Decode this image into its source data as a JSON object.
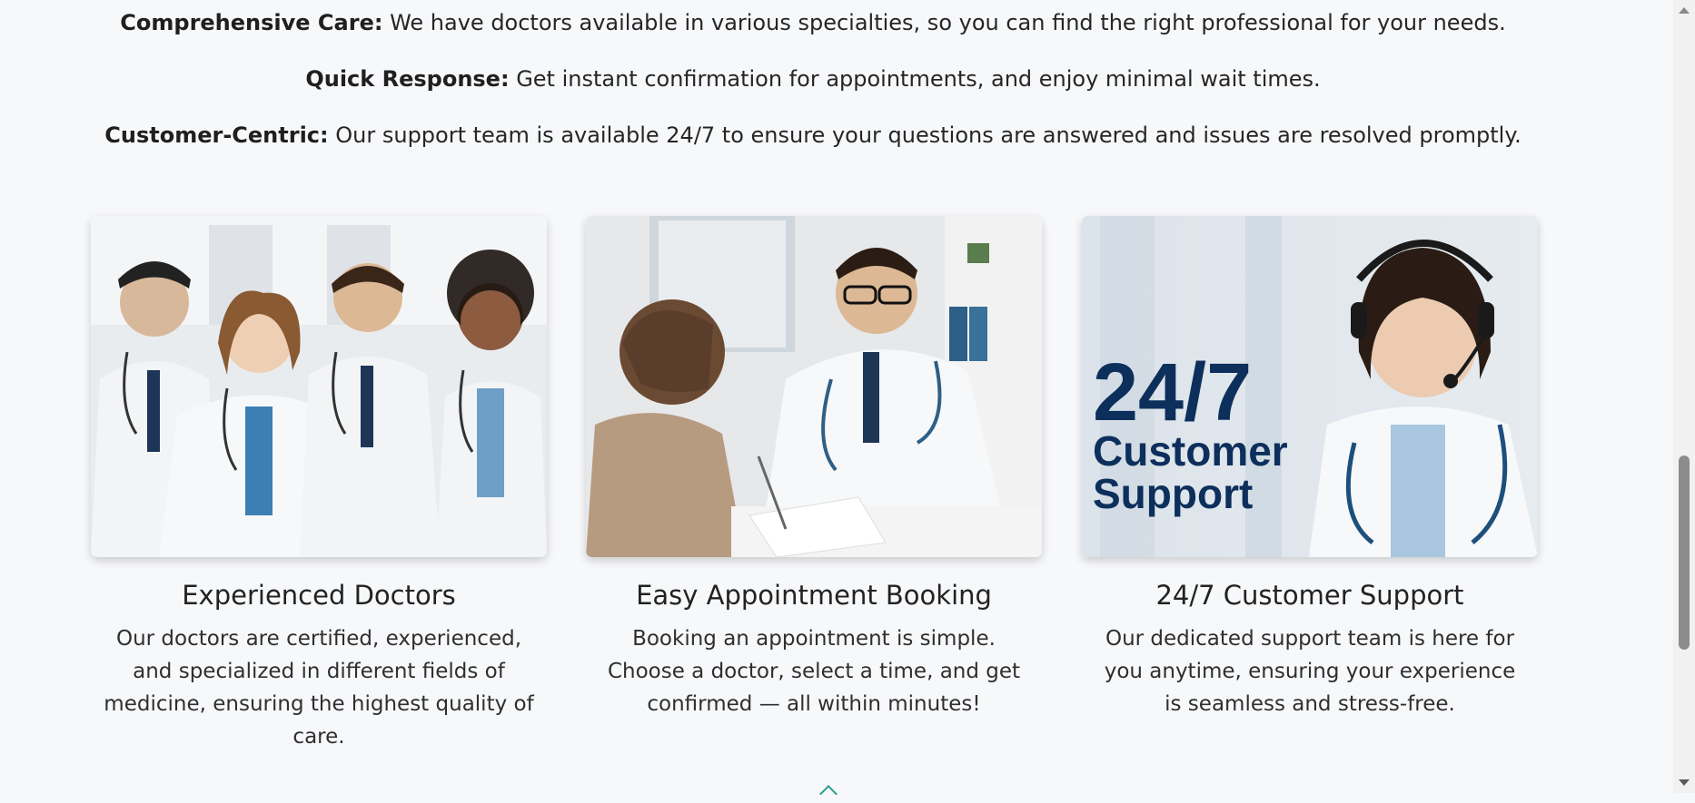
{
  "intro": [
    {
      "label": "Comprehensive Care:",
      "text": " We have doctors available in various specialties, so you can find the right professional for your needs."
    },
    {
      "label": "Quick Response:",
      "text": " Get instant confirmation for appointments, and enjoy minimal wait times."
    },
    {
      "label": "Customer-Centric:",
      "text": " Our support team is available 24/7 to ensure your questions are answered and issues are resolved promptly."
    }
  ],
  "cards": [
    {
      "title": "Experienced Doctors",
      "text": "Our doctors are certified, experienced, and specialized in different fields of medicine, ensuring the highest quality of care."
    },
    {
      "title": "Easy Appointment Booking",
      "text": "Booking an appointment is simple. Choose a doctor, select a time, and get confirmed — all within minutes!"
    },
    {
      "title": "24/7 Customer Support",
      "text": "Our dedicated support team is here for you anytime, ensuring your experience is seamless and stress-free.",
      "image_text": {
        "big": "24/7",
        "line1": "Customer",
        "line2": "Support"
      }
    }
  ],
  "colors": {
    "navy": "#0d2f5c",
    "coat": "#f3f4f6",
    "teal": "#2a9d8f"
  }
}
